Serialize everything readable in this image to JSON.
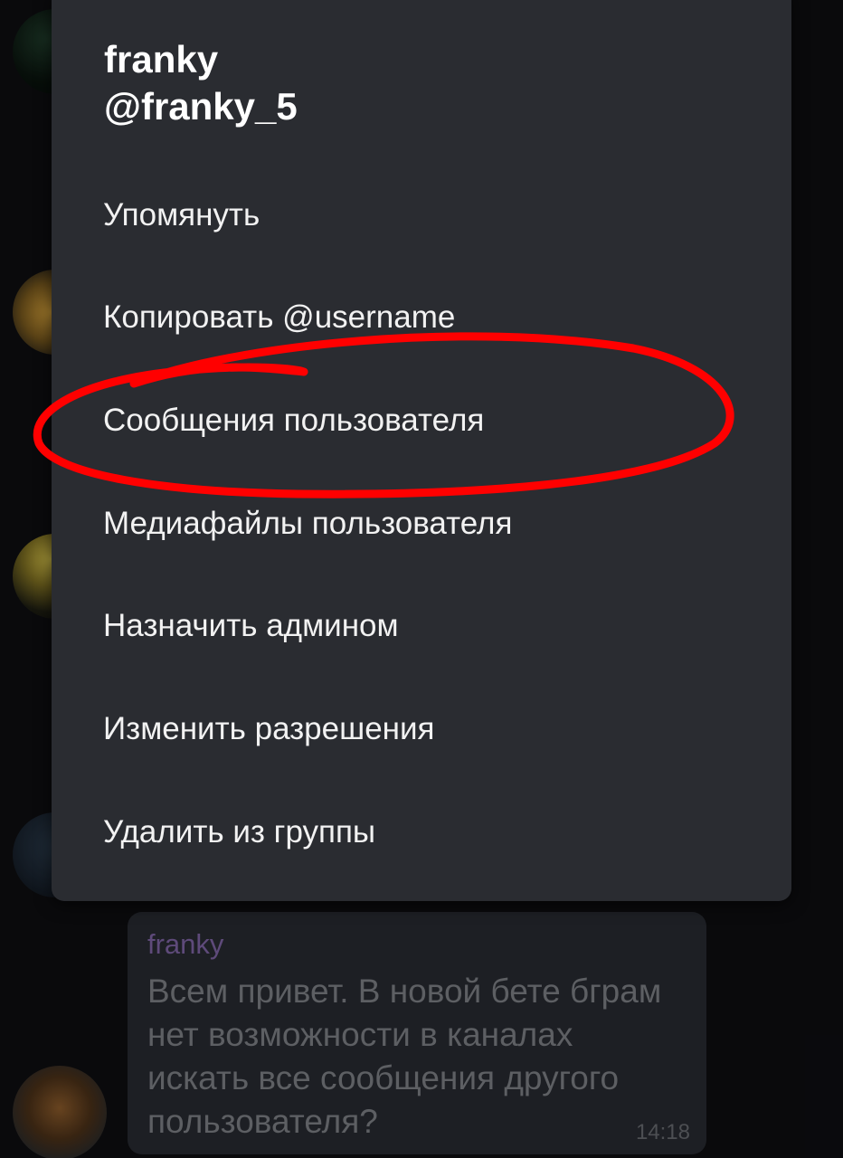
{
  "menu": {
    "display_name": "franky",
    "username": "@franky_5",
    "items": [
      {
        "label": "Упомянуть"
      },
      {
        "label": "Копировать @username"
      },
      {
        "label": "Сообщения пользователя"
      },
      {
        "label": "Медиафайлы пользователя"
      },
      {
        "label": "Назначить админом"
      },
      {
        "label": "Изменить разрешения"
      },
      {
        "label": "Удалить из группы"
      }
    ]
  },
  "message": {
    "sender": "franky",
    "text": "Всем привет. В новой бете бграм\nнет возможности в каналах\nискать все сообщения  другого\nпользователя?",
    "time": "14:18"
  },
  "annotation": {
    "color": "#ff0000",
    "shape": "ellipse around menu item 3"
  }
}
